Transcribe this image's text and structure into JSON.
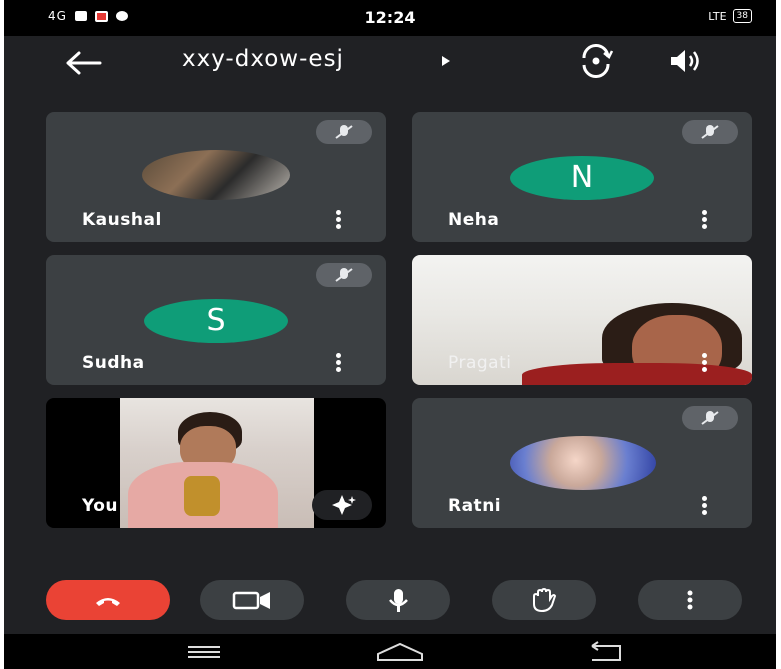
{
  "status_bar": {
    "network": "4G",
    "time": "12:24",
    "lte": "LTE",
    "battery": "38"
  },
  "header": {
    "meeting_code": "xxy-dxow-esj"
  },
  "participants": [
    {
      "name": "Kaushal",
      "type": "photo"
    },
    {
      "name": "Neha",
      "type": "initial",
      "initial": "N"
    },
    {
      "name": "Sudha",
      "type": "initial",
      "initial": "S"
    },
    {
      "name": "Pragati",
      "type": "video"
    },
    {
      "name": "You",
      "type": "video"
    },
    {
      "name": "Ratni",
      "type": "photo"
    }
  ],
  "controls": [
    "end-call",
    "camera",
    "microphone",
    "raise-hand",
    "more-options"
  ],
  "colors": {
    "background": "#202124",
    "tile": "#3c4043",
    "end_call": "#ea4335",
    "avatar_green": "#0f9d78"
  }
}
